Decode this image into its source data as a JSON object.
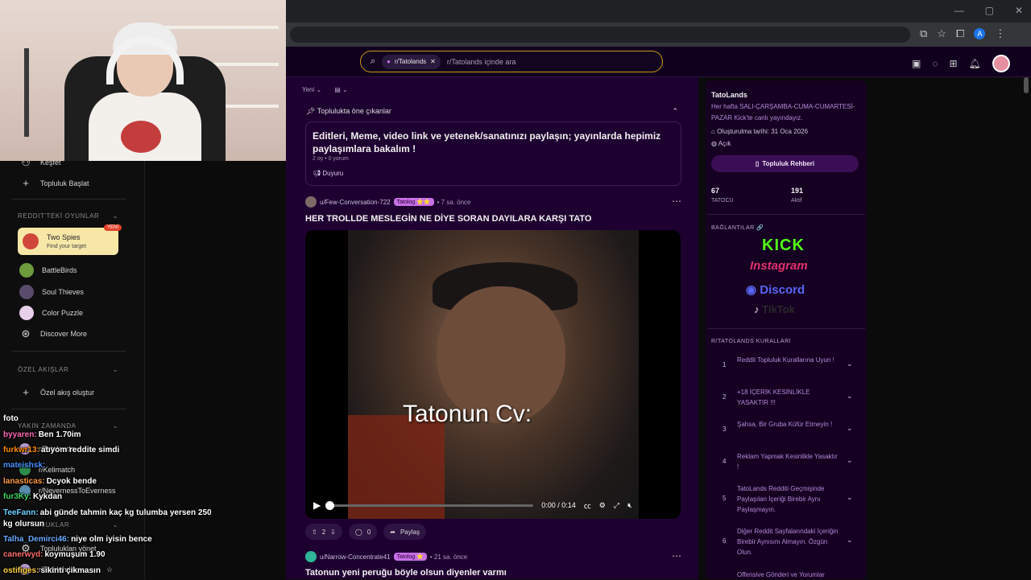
{
  "browser": {
    "window_controls": [
      "—",
      "▢",
      "✕"
    ],
    "account_initial": "A"
  },
  "search": {
    "chip_label": "r/Tatolands",
    "placeholder": "r/Tatolands içinde ara"
  },
  "left_sidebar": {
    "explore_label": "Keşfet",
    "start_community_label": "Topluluk Başlat",
    "games_section": "REDDIT'TEKİ OYUNLAR",
    "featured_game": {
      "title": "Two Spies",
      "subtitle": "Find your target",
      "badge": "YENİ"
    },
    "games": [
      "BattleBirds",
      "Soul Thieves",
      "Color Puzzle"
    ],
    "discover_more": "Discover More",
    "custom_feeds_section": "ÖZEL AKIŞLAR",
    "create_feed": "Özel akış oluştur",
    "recent_section": "YAKIN ZAMANDA",
    "recent_items": [
      "r/Tatolands",
      "r/Kelimatch",
      "r/NevernessToEverness"
    ],
    "communities_section": "TOPLULUKLAR",
    "manage_communities": "Topluluklan yönet",
    "bottom_item": "r/Tatolands"
  },
  "chat": [
    {
      "user": "",
      "msg": "foto",
      "color": "#ffffff"
    },
    {
      "user": "byyaren:",
      "msg": "Ben 1.70im",
      "color": "#ff69b4"
    },
    {
      "user": "furkwr13:",
      "msg": "atıyom reddite simdi",
      "color": "#ff8c00"
    },
    {
      "user": "mateishsk:",
      "msg": "",
      "color": "#4a8fff"
    },
    {
      "user": "lanasticas:",
      "msg": "Dcyok bende",
      "color": "#ff9a3d"
    },
    {
      "user": "fur3Ky:",
      "msg": "Kykdan",
      "color": "#3ad65f"
    },
    {
      "user": "TeeFann:",
      "msg": "abi günde tahmin kaç kg tulumba yersen 250",
      "color": "#6fd0ff"
    },
    {
      "user": "",
      "msg": "kg olursun",
      "color": "#ffffff"
    },
    {
      "user": "Talha_Demirci46:",
      "msg": "niye olm iyisin bence",
      "color": "#6aa8ff"
    },
    {
      "user": "canerwyd:",
      "msg": "koymuşum 1.90",
      "color": "#ff6b6b"
    },
    {
      "user": "ostifiges:",
      "msg": "sikinti çikmasın",
      "color": "#ffd23a"
    }
  ],
  "feed": {
    "sort_label": "Yeni",
    "highlights_label": "Toplulukta öne çıkanlar",
    "pinned": {
      "title": "Editleri, Meme, video link ve yetenek/sanatınızı paylaşın; yayınlarda hepimiz paylaşımlara bakalım !",
      "meta": "2 oy • 0 yorum",
      "tag": "Duyuru"
    },
    "post1": {
      "user": "u/Few-Conversation-722",
      "flair": "Tatolog ⭐⭐",
      "time": "7 sa. önce",
      "title": "HER TROLLDE MESLEGİN NE DİYE SORAN DAYILARA KARŞI TATO",
      "caption": "Tatonun Cv:",
      "time_display": "0:00 / 0:14",
      "progress": 0,
      "votes": "2",
      "comments": "0",
      "share": "Paylaş"
    },
    "post2": {
      "user": "u/Narrow-Concentrate41",
      "flair": "Tatolog ⭐",
      "time": "21 sa. önce",
      "title": "Tatonun yeni peruğu böyle olsun diyenler varmı"
    }
  },
  "right_sidebar": {
    "name": "TatoLands",
    "description": "Her hafta SALI-ÇARŞAMBA-CUMA-CUMARTESİ-PAZAR Kick'te canlı yayındayız.",
    "created": "Oluşturulma tarihi: 31 Oca 2026",
    "visibility": "Açık",
    "guide_button": "Topluluk Rehberi",
    "members": "67",
    "members_label": "TATOCU",
    "online": "191",
    "online_label": "Aktif",
    "links_title": "BAĞLANTILAR 🔗",
    "links": [
      "KICK",
      "Instagram",
      "Discord",
      "TikTok"
    ],
    "rules_title": "R/TATOLANDS KURALLARI",
    "rules": [
      "Reddit Topluluk Kurallarına Uyun !",
      "+18 İÇERİK KESİNLİKLE YASAKTIR !!!",
      "Şahsa, Bir Gruba Küfür Etmeyin !",
      "Reklam Yapmak Kesinlikle Yasaktır !",
      "TatoLands Redditi Geçmişinde Paylaşılan İçeriği Birebir Aynı Paylaşmayın.",
      "Diğer Reddit Sayfalarındaki İçeriğin Birebir Aynısını Almayın. Özgün Olun.",
      "Offensive Gönderi ve Yorumlar"
    ]
  },
  "colors": {
    "accent": "#c99a12",
    "kick": "#53fc18",
    "discord": "#5865f2",
    "instagram": "#e1306c",
    "flair": "#c86fe6"
  }
}
